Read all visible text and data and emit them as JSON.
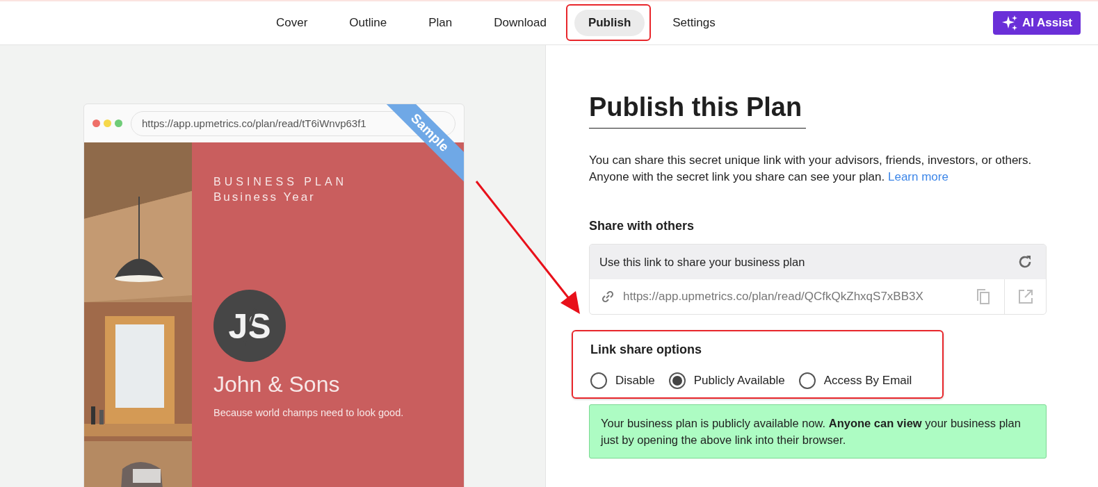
{
  "nav": {
    "tabs": [
      {
        "label": "Cover",
        "selected": false,
        "highlighted": false
      },
      {
        "label": "Outline",
        "selected": false,
        "highlighted": false
      },
      {
        "label": "Plan",
        "selected": false,
        "highlighted": false
      },
      {
        "label": "Download",
        "selected": false,
        "highlighted": false
      },
      {
        "label": "Publish",
        "selected": true,
        "highlighted": true
      },
      {
        "label": "Settings",
        "selected": false,
        "highlighted": false
      }
    ],
    "ai_button": "AI Assist"
  },
  "preview": {
    "address": "https://app.upmetrics.co/plan/read/tT6iWnvp63f1",
    "ribbon": "Sample",
    "cover": {
      "kind": "picture",
      "eyebrow": "BUSINESS PLAN",
      "year": "Business Year",
      "logo_text": "JS",
      "company": "John & Sons",
      "tagline": "Because world champs need to look good."
    }
  },
  "annotation_arrow": true,
  "publish": {
    "title": "Publish this Plan",
    "description": "You can share this secret unique link with your advisors, friends, investors, or others. Anyone with the secret link you share can see your plan.",
    "learn_more": "Learn more",
    "share_heading": "Share with others",
    "link_box": {
      "header": "Use this link to share your business plan",
      "url": "https://app.upmetrics.co/plan/read/QCfkQkZhxqS7xBB3X"
    },
    "options": {
      "heading": "Link share options",
      "highlighted": true,
      "choices": [
        {
          "label": "Disable",
          "selected": false
        },
        {
          "label": "Publicly Available",
          "selected": true
        },
        {
          "label": "Access By Email",
          "selected": false
        }
      ]
    },
    "notice": "Your business plan is publicly available now. **Anyone can view** your business plan just by opening the above link into their browser."
  }
}
